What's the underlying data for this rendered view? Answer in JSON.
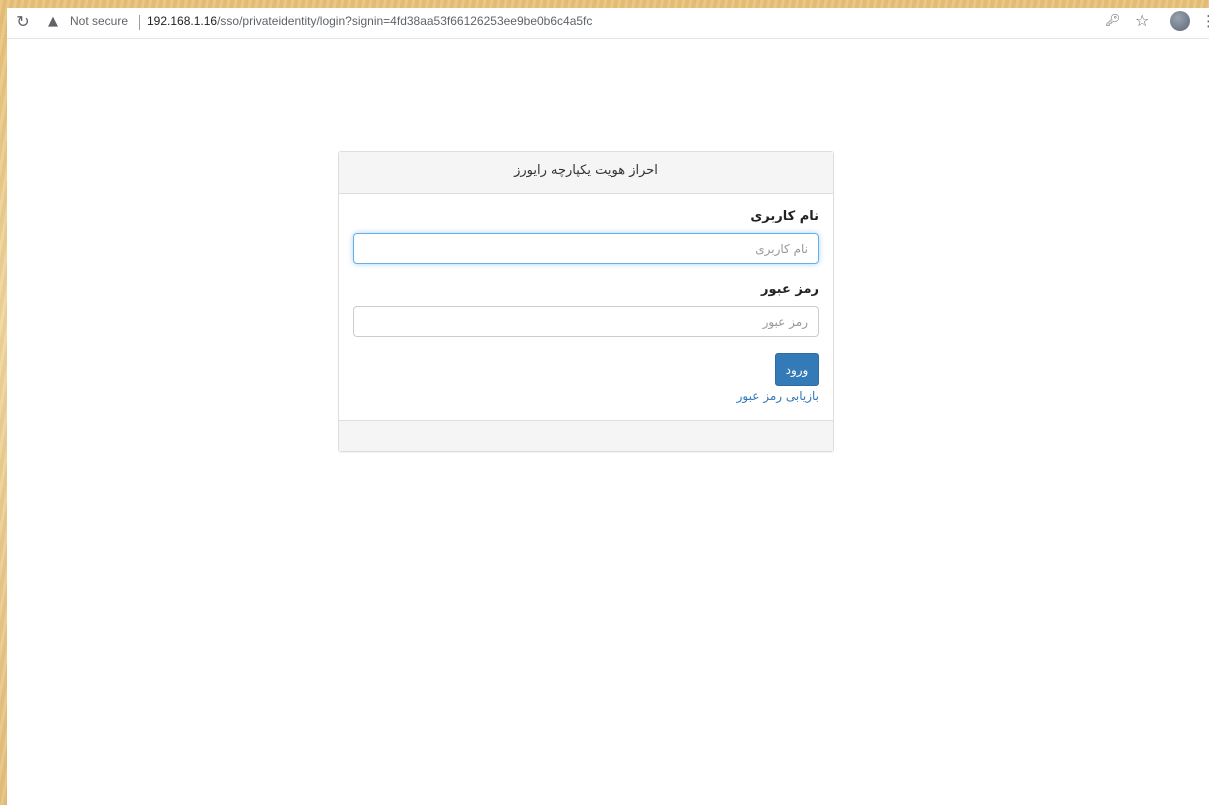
{
  "browser": {
    "security_label": "Not secure",
    "url_host": "192.168.1.16",
    "url_path": "/sso/privateidentity/login?signin=4fd38aa53f66126253ee9be0b6c4a5fc"
  },
  "panel": {
    "title": "احراز هویت یکپارچه رایورز"
  },
  "form": {
    "username_label": "نام کاربری",
    "username_placeholder": "نام کاربری",
    "password_label": "رمز عبور",
    "password_placeholder": "رمز عبور",
    "login_button": "ورود",
    "forgot_link": "بازیابی رمز عبور"
  },
  "colors": {
    "primary": "#337ab7",
    "focus_border": "#66afe9"
  }
}
